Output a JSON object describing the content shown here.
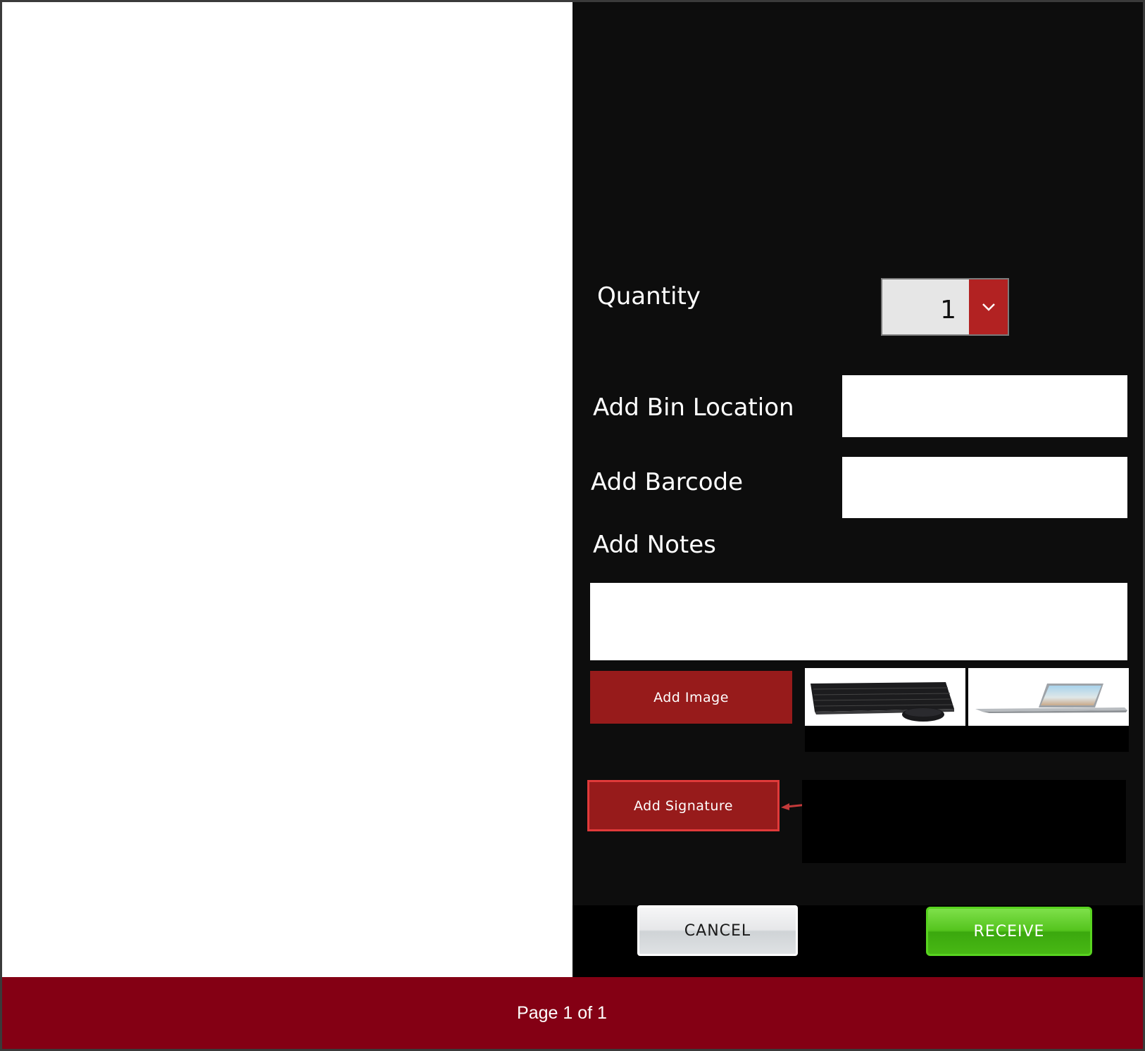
{
  "form": {
    "quantity_label": "Quantity",
    "quantity_value": "1",
    "bin_location_label": "Add Bin Location",
    "barcode_label": "Add Barcode",
    "notes_label": "Add Notes",
    "add_image_label": "Add Image",
    "add_signature_label": "Add Signature",
    "images": [
      {
        "name": "keyboard-mouse-image"
      },
      {
        "name": "laptop-image"
      }
    ]
  },
  "actions": {
    "cancel_label": "CANCEL",
    "receive_label": "RECEIVE"
  },
  "footer": {
    "page_label": "Page 1 of 1"
  },
  "colors": {
    "accent_red": "#971b1b",
    "footer_red": "#840014",
    "receive_green": "#48b814",
    "annotation_red": "#e03a3a"
  }
}
